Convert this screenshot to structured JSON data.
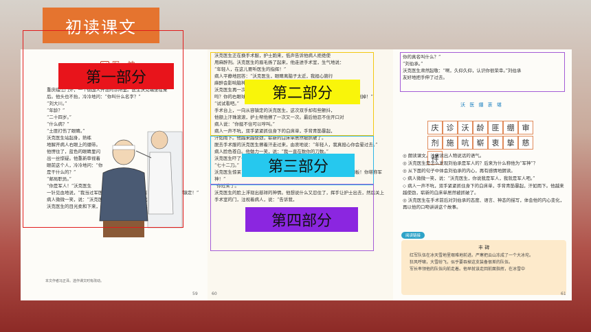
{
  "slide": {
    "title": "初读课文"
  },
  "labels": {
    "part1": "第一部分",
    "part2": "第二部分",
    "part3": "第三部分",
    "part4": "第四部分"
  },
  "page59": {
    "lesson_number": "11",
    "lesson_name": "军 神",
    "lines": [
      "重庆临江门外，一个德国人开设的诊所里。医生沃克端坐在桌",
      "后。他头也不抬，冷冷地问：“你叫什么名字？”",
      "“刘大川。”",
      "“年龄？”",
      "“二十四岁。”",
      "“什么病？”",
      "“土匪打伤了眼睛。”",
      "沃克医生站起身，熟练",
      "地解开病人右眼上的绷带。",
      "他愣住了，蓝色的眼睛里闪",
      "出一丝惊疑。他重新审视着",
      "眼前这个人，冷冷地问：“你",
      "是干什么的？”",
      "“邮局职员。”",
      "“你是军人！”沃克医生",
      "一针见血地说，“我当过军医，这么重的伤势，只有军人才能这样从容镇定！”",
      "病人微微一笑，说：“沃克医生，你说我是军人，我就是军人吧。”",
      "沃克医生的目光柔和下来，他吩咐护士：“准备手术。”"
    ],
    "footnote": "本文作者冯正泽。选作课文时有改动。",
    "page_number": "59"
  },
  "page60": {
    "lines": [
      "沃克医生正在换手术服，护士跑来，低声告诉他病人拒绝使",
      "用麻醉剂。沃克医生的眉毛扬了起来，他走进手术室，生气地说：",
      "“年轻人，在这儿要听医生的指挥！”",
      "病人平静地回答：“沃克医生，眼睛离脑子太近，我担心施行",
      "麻醉会影响脑神经。而我，以后需要一个非常清醒的大脑！”",
      "沃克医生再一次愣住了，竟有点儿口吃地说：“你，你能忍受",
      "吗？你的右眼球已经坏死，我必须把它摘除，把烂肉和新生的息肉一刀刀割掉！”",
      "“试试看吧。”",
      "手术台上，一向从容镇定的沃克医生，这次双手却有些颤抖，",
      "他额上汗珠滚滚，护士帮他擦了一次又一次。最后他忍不住开口对",
      "病人说：“你挺不住可以哼叫。”",
      "病人一声不吭，双手紧紧抓住身下的白床单，手背青筋暴起，",
      "汗如雨下。他越来越使劲，崭新的白床单居然被抓破了。",
      "脱去手术服的沃克医生擦着汗走过来，由衷地说：“年轻人，我真担心你会晕过去。”",
      "病人脸色苍白。他勉力一笑，说：“我一直在数你的刀数。”",
      "沃克医生吓了一跳，不相信地问：“我割了多少刀？”",
      "“七十二刀。”",
      "沃克医生惊呆了，大声嚷道：“你是一个真正的男子汉，一块会说话的钢板！你堪称军神！”",
      "“你过奖了。”",
      "沃克医生的脸上浮现出慈祥的神情。他想说什么又忍住了，挥手让护士出去，然后关上手术室的门，注视着病人，说：“告诉我，"
    ],
    "page_number": "60"
  },
  "page61": {
    "lines": [
      "你的真名叫什么？”",
      "“刘伯承。”",
      "沃克医生肃然起敬：“啊，久仰久仰，认识你很荣幸。”刘伯承",
      "友好地把手伸了过去。"
    ],
    "vocab_title": "沃 医 绷 衷 堪",
    "vocab_chars": [
      "庆",
      "诊",
      "沃",
      "龄",
      "匪",
      "绷",
      "审",
      "剂",
      "施",
      "吭",
      "崭",
      "衷",
      "挚",
      "慈",
      "祥"
    ],
    "exercises": [
      "◎ 朗读课文。注意读出人物说话的语气。",
      "◎ 沃克医生是怎么发现刘伯承是军人的？后来为什么称他为“军神”？",
      "◎ 从下面的句子中体会刘伯承的内心，再有感情地朗读。",
      "◇ 病人微微一笑，说：“沃克医生，你说我是军人，我就是军人吧。”",
      "◇ 病人一声不吭，双手紧紧抓住身下的白床单，手背青筋暴起，汗如雨下。他越来越使劲，崭新的白床单居然被抓破了。",
      "◎ 沃克医生在手术前后对刘伯承的态度、语言、神态的描写，体会他的内心变化，再以他的口吻讲讲这个故事。"
    ],
    "extension_badge": "阅读链接",
    "extension_title": "丰 碑",
    "extension_text": [
      "红军队伍在冰天雪地里艰难地前进。严寒把云山冻成了一个大冰坨。",
      "狂风呼啸，大雪纷飞，似乎要吞掉这支装备很差的队伍。",
      "军长率领他的队伍向前走着。他早就该走回前面指挥，在冰雪中"
    ],
    "page_number": "61"
  }
}
